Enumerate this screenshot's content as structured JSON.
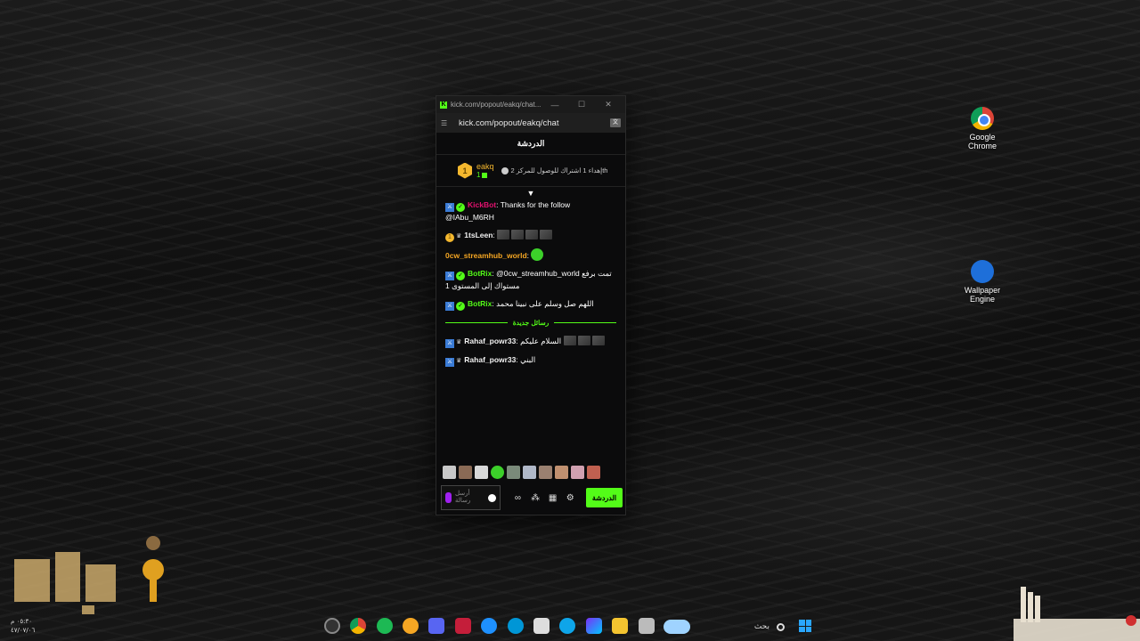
{
  "desktop": {
    "icons": [
      {
        "label_line1": "Google",
        "label_line2": "Chrome",
        "icon": "chrome-icon"
      },
      {
        "label_line1": "Wallpaper",
        "label_line2": "Engine",
        "icon": "wallpaper-engine-icon"
      }
    ],
    "clock": {
      "time": "٠٥:٣٠ م",
      "date": "٤٧/٠٧/٠٦"
    }
  },
  "popup": {
    "title": "kick.com/popout/eakq/chat...",
    "window_controls": {
      "minimize": "—",
      "maximize": "☐",
      "close": "✕"
    },
    "address": "kick.com/popout/eakq/chat",
    "chat_header": "الدردشة",
    "pinned": {
      "badge": "1",
      "username": "eakq",
      "sub_count": "1",
      "text": "إهداء 1 اشتراك للوصول للمركز 2th"
    },
    "messages": [
      {
        "username": "KickBot",
        "color": "#e4116f",
        "text": ": Thanks for the follow @IAbu_M6RH",
        "badges": [
          "mod",
          "verified"
        ]
      },
      {
        "username": "1tsLeen",
        "color": "#f2f2f2",
        "text": ":",
        "badges": [
          "gold",
          "crown"
        ],
        "emotes": 4
      },
      {
        "username": "0cw_streamhub_world",
        "color": "#f5a623",
        "text": ":",
        "badges": [],
        "green_emote": true
      },
      {
        "username": "BotRix",
        "color": "#53fc18",
        "text": ": @0cw_streamhub_world تمت برفع مستواك إلى المستوى 1",
        "badges": [
          "mod",
          "verified"
        ]
      },
      {
        "username": "BotRix",
        "color": "#53fc18",
        "text": ": اللهم صل وسلم على نبينا محمد",
        "badges": [
          "mod",
          "verified"
        ]
      }
    ],
    "new_messages_label": "رسائل جديدة",
    "new_messages": [
      {
        "username": "Rahaf_powr33",
        "color": "#f2f2f2",
        "text": ": السلام عليكم",
        "badges": [
          "mod",
          "crown"
        ],
        "emotes": 3
      },
      {
        "username": "Rahaf_powr33",
        "color": "#f2f2f2",
        "text": ": البني",
        "badges": [
          "mod",
          "crown"
        ]
      }
    ],
    "input_placeholder": "أرسل رسالة",
    "chat_button": "الدردشة"
  },
  "taskbar": {
    "search_placeholder": "بحث"
  },
  "colors": {
    "kick_green": "#53fc18",
    "gold": "#f5b82e"
  }
}
